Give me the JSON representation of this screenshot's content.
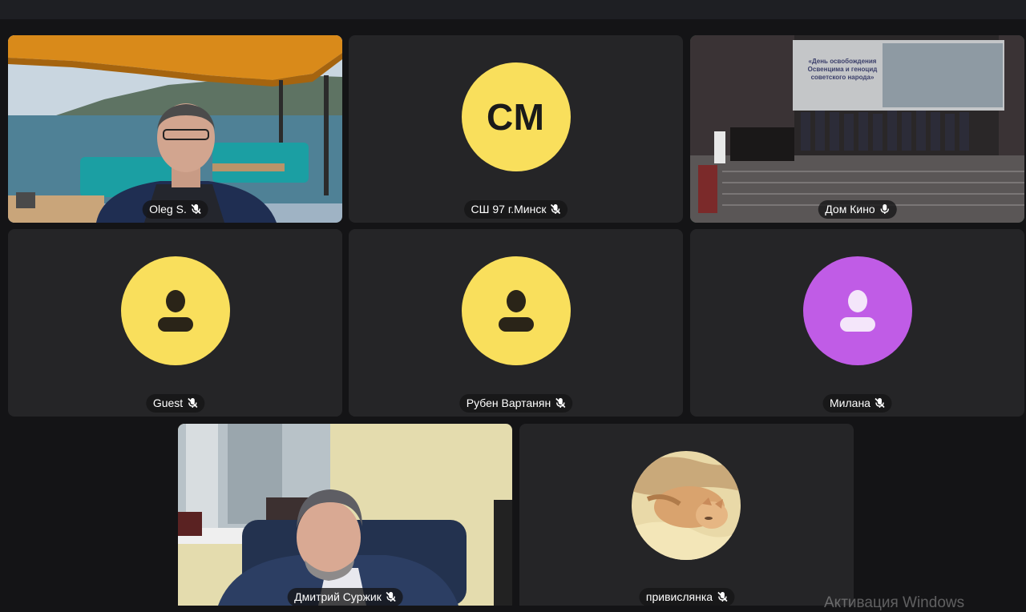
{
  "participants": [
    {
      "name": "Oleg S.",
      "mic": "muted"
    },
    {
      "name": "СШ 97 г.Минск",
      "initials": "СМ",
      "mic": "muted"
    },
    {
      "name": "Дом Кино",
      "mic": "on",
      "active": true
    },
    {
      "name": "Guest",
      "mic": "muted"
    },
    {
      "name": "Рубен Вартанян",
      "mic": "muted"
    },
    {
      "name": "Милана",
      "mic": "muted"
    },
    {
      "name": "Дмитрий Суржик",
      "mic": "muted"
    },
    {
      "name": "привислянка",
      "mic": "muted"
    }
  ],
  "stage_screen_text": "«День освобождения Освенцима и геноцид советского народа»",
  "watermark": "Активация Windows",
  "colors": {
    "active_border": "#3ee07e",
    "avatar_yellow": "#f9df5c",
    "avatar_purple": "#c05ce6"
  }
}
